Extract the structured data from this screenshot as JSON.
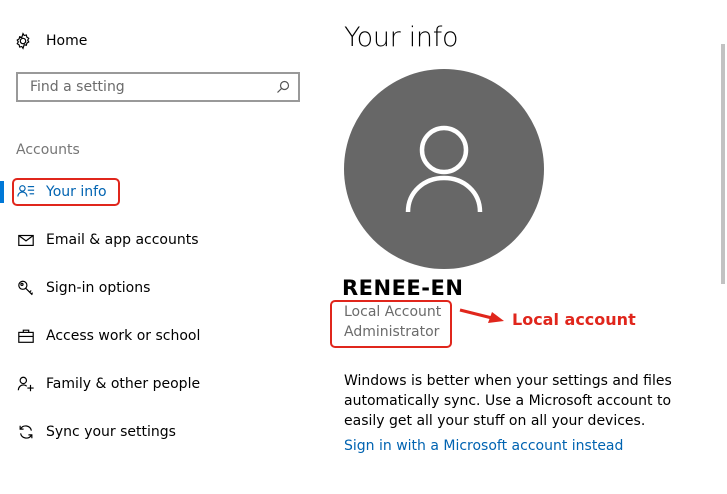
{
  "sidebar": {
    "home_label": "Home",
    "search_placeholder": "Find a setting",
    "section_title": "Accounts",
    "items": [
      {
        "label": "Your info",
        "icon": "person-list-icon",
        "selected": true
      },
      {
        "label": "Email & app accounts",
        "icon": "mail-icon"
      },
      {
        "label": "Sign-in options",
        "icon": "key-icon"
      },
      {
        "label": "Access work or school",
        "icon": "briefcase-icon"
      },
      {
        "label": "Family & other people",
        "icon": "person-add-icon"
      },
      {
        "label": "Sync your settings",
        "icon": "sync-icon"
      }
    ]
  },
  "main": {
    "title": "Your info",
    "user_name": "RENEE-EN",
    "account_type": "Local Account",
    "account_role": "Administrator",
    "annotation": "Local account",
    "info_text": "Windows is better when your settings and files automatically sync. Use a Microsoft account to easily get all your stuff on all your devices.",
    "link_label": "Sign in with a Microsoft account instead"
  },
  "colors": {
    "accent": "#0078d7",
    "link": "#0063b1",
    "annotation": "#e0261c",
    "avatar_bg": "#676767"
  }
}
